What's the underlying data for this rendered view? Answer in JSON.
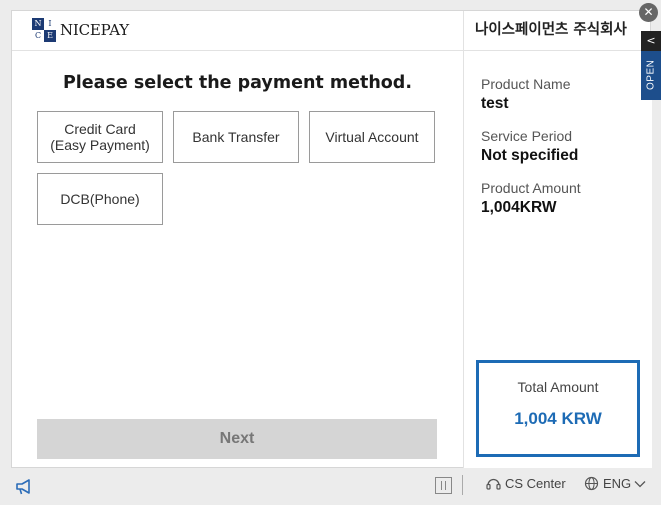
{
  "header": {
    "logo_text": "NICEPAY",
    "logo_mark": [
      "N",
      "I",
      "C",
      "E"
    ],
    "company_name": "나이스페이먼츠 주식회사"
  },
  "main": {
    "title": "Please select the payment method.",
    "methods": [
      {
        "label": "Credit Card\n(Easy Payment)"
      },
      {
        "label": "Bank Transfer"
      },
      {
        "label": "Virtual Account"
      },
      {
        "label": "DCB(Phone)"
      }
    ],
    "next_label": "Next"
  },
  "info": {
    "product_name_label": "Product Name",
    "product_name_value": "test",
    "service_period_label": "Service Period",
    "service_period_value": "Not specified",
    "product_amount_label": "Product Amount",
    "product_amount_value": "1,004KRW",
    "total_label": "Total Amount",
    "total_value": "1,004 KRW"
  },
  "side": {
    "close_glyph": "✕",
    "open_chevron": "<",
    "open_label": "OPEN"
  },
  "footer": {
    "cs_label": "CS Center",
    "lang_label": "ENG"
  },
  "colors": {
    "accent_blue": "#1d6bb5",
    "logo_navy": "#1c3a73",
    "open_tab_blue": "#1d4e8c",
    "next_disabled_bg": "#d5d5d5"
  },
  "icons": {
    "notice": "megaphone-icon",
    "panel": "panel-toggle-icon",
    "cs": "headset-icon",
    "lang": "globe-icon",
    "lang_caret": "chevron-down-icon",
    "close": "close-icon"
  }
}
